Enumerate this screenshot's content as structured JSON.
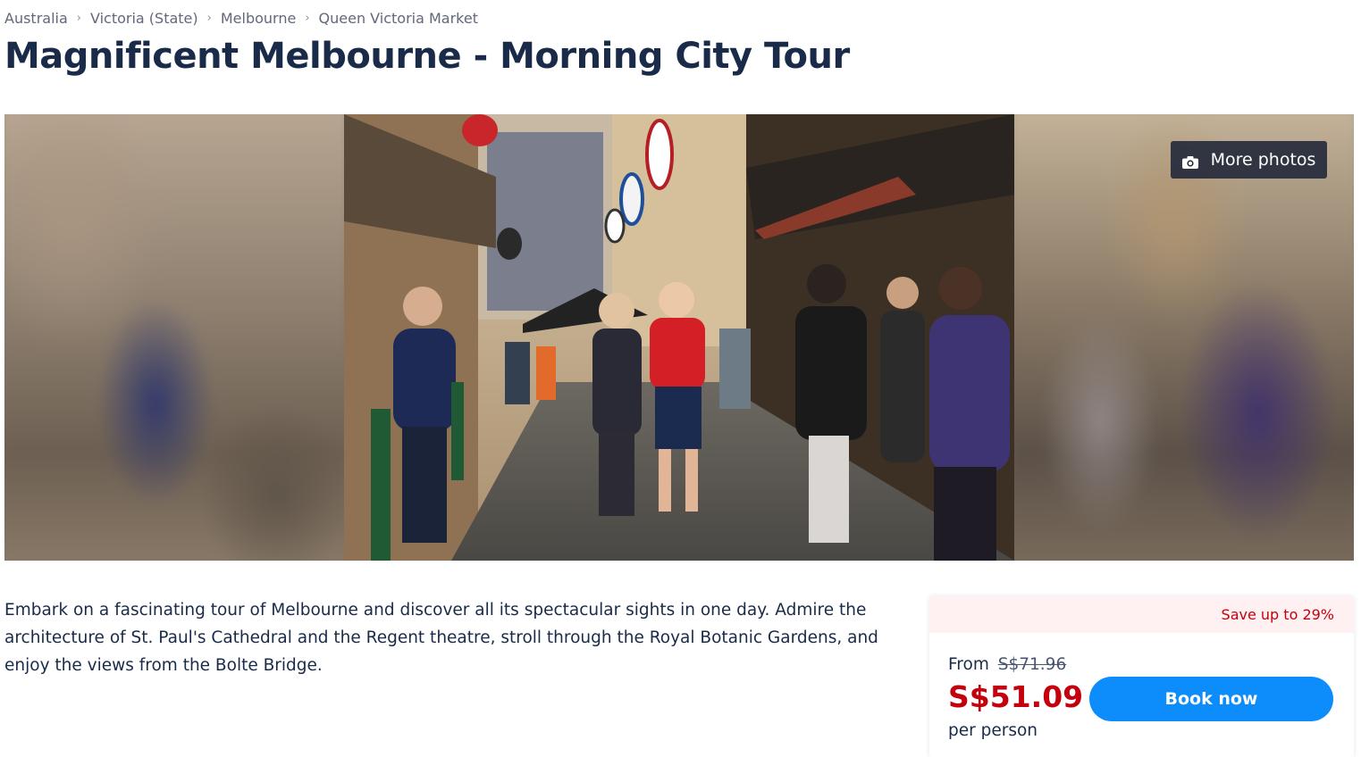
{
  "breadcrumb": {
    "items": [
      "Australia",
      "Victoria (State)",
      "Melbourne",
      "Queen Victoria Market"
    ],
    "separator": "›"
  },
  "page": {
    "title": "Magnificent Melbourne - Morning City Tour"
  },
  "gallery": {
    "more_photos_label": "More photos",
    "icon": "camera-icon"
  },
  "description": {
    "text": "Embark on a fascinating tour of Melbourne and discover all its spectacular sights in one day. Admire the architecture of St. Paul's Cathedral and the Regent theatre, stroll through the Royal Botanic Gardens, and enjoy the views from the Bolte Bridge."
  },
  "pricing": {
    "save_label": "Save up to 29%",
    "from_label": "From",
    "original_price": "S$71.96",
    "current_price": "S$51.09",
    "per_label": "per person",
    "book_label": "Book now"
  },
  "colors": {
    "text": "#1a2b49",
    "accent_blue": "#0d8cfc",
    "price_red": "#c4000d",
    "save_bg": "#fff1f1"
  }
}
